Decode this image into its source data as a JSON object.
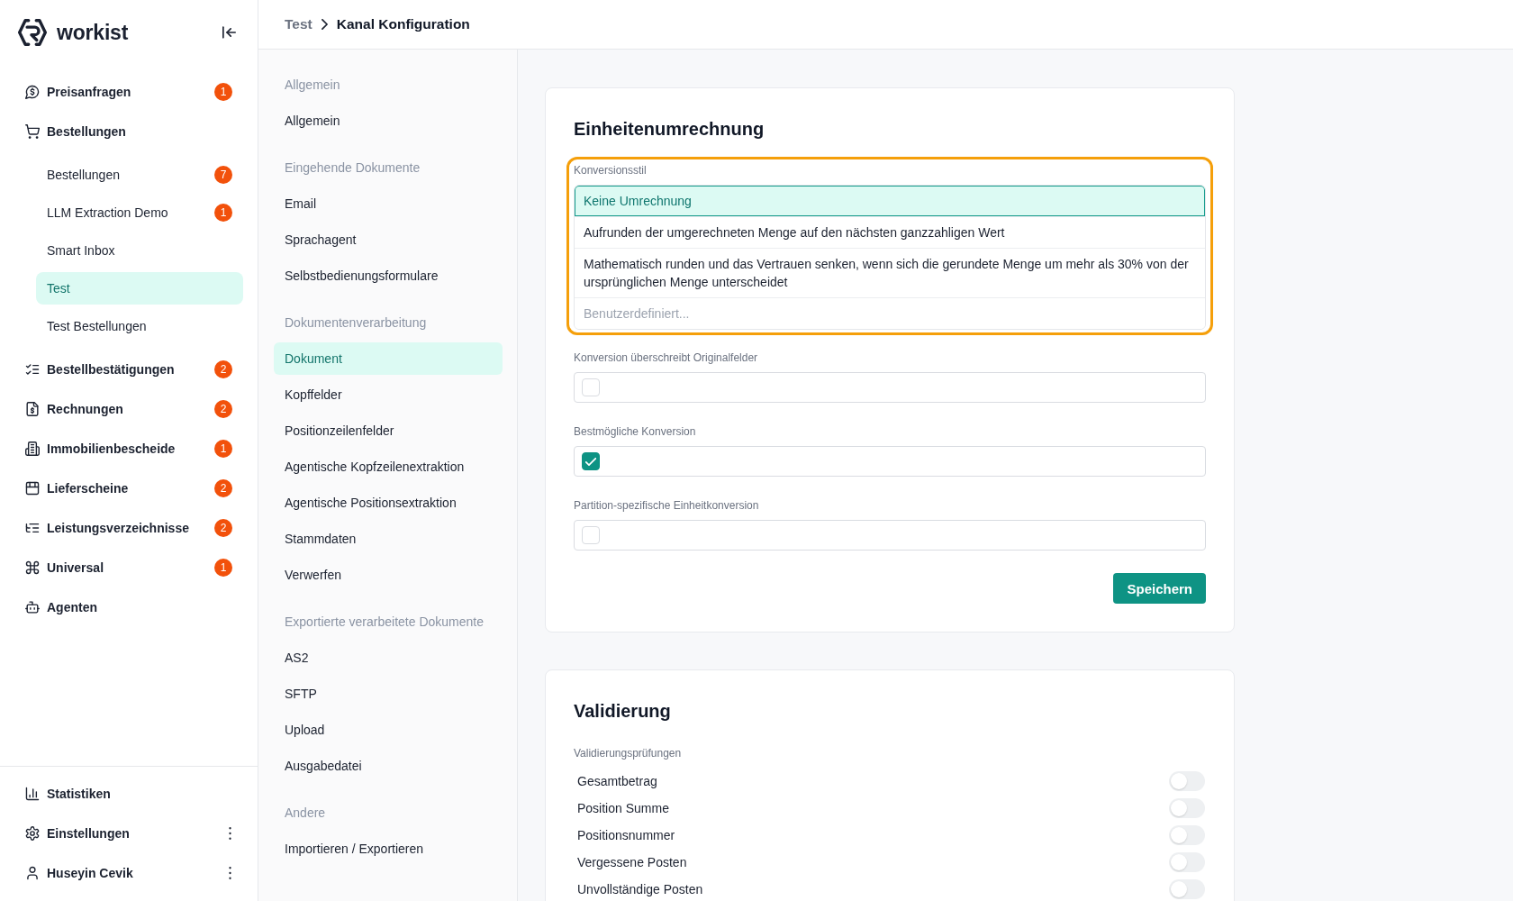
{
  "sidebar": {
    "logo": "workist",
    "nav": [
      {
        "label": "Preisanfragen",
        "badge": "1",
        "selected": false
      },
      {
        "label": "Bestellungen",
        "selected": false,
        "children": [
          {
            "label": "Bestellungen",
            "badge": "7",
            "selected": false
          },
          {
            "label": "LLM Extraction Demo",
            "badge": "1",
            "selected": false
          },
          {
            "label": "Smart Inbox",
            "selected": false
          },
          {
            "label": "Test",
            "selected": true
          },
          {
            "label": "Test Bestellungen",
            "selected": false
          }
        ]
      },
      {
        "label": "Bestellbestätigungen",
        "badge": "2",
        "selected": false
      },
      {
        "label": "Rechnungen",
        "badge": "2",
        "selected": false
      },
      {
        "label": "Immobilienbescheide",
        "badge": "1",
        "selected": false
      },
      {
        "label": "Lieferscheine",
        "badge": "2",
        "selected": false
      },
      {
        "label": "Leistungsverzeichnisse",
        "badge": "2",
        "selected": false
      },
      {
        "label": "Universal",
        "badge": "1",
        "selected": false
      },
      {
        "label": "Agenten",
        "selected": false
      }
    ],
    "footer": [
      {
        "label": "Statistiken",
        "selected": false,
        "menu": false
      },
      {
        "label": "Einstellungen",
        "selected": false,
        "menu": true
      },
      {
        "label": "Huseyin Cevik",
        "selected": false,
        "menu": true
      }
    ]
  },
  "breadcrumb": [
    "Test",
    "Kanal Konfiguration"
  ],
  "config_nav": [
    {
      "heading": "Allgemein",
      "items": [
        {
          "label": "Allgemein",
          "selected": false
        }
      ]
    },
    {
      "heading": "Eingehende Dokumente",
      "items": [
        {
          "label": "Email",
          "selected": false
        },
        {
          "label": "Sprachagent",
          "selected": false
        },
        {
          "label": "Selbstbedienungsformulare",
          "selected": false
        }
      ]
    },
    {
      "heading": "Dokumentenverarbeitung",
      "items": [
        {
          "label": "Dokument",
          "selected": true
        },
        {
          "label": "Kopffelder",
          "selected": false
        },
        {
          "label": "Positionzeilenfelder",
          "selected": false
        },
        {
          "label": "Agentische Kopfzeilenextraktion",
          "selected": false
        },
        {
          "label": "Agentische Positionsextraktion",
          "selected": false
        },
        {
          "label": "Stammdaten",
          "selected": false
        },
        {
          "label": "Verwerfen",
          "selected": false
        }
      ]
    },
    {
      "heading": "Exportierte verarbeitete Dokumente",
      "items": [
        {
          "label": "AS2",
          "selected": false
        },
        {
          "label": "SFTP",
          "selected": false
        },
        {
          "label": "Upload",
          "selected": false
        },
        {
          "label": "Ausgabedatei",
          "selected": false
        }
      ]
    },
    {
      "heading": "Andere",
      "items": [
        {
          "label": "Importieren / Exportieren",
          "selected": false
        }
      ]
    }
  ],
  "unit_conversion": {
    "title": "Einheitenumrechnung",
    "conversion_style": {
      "label": "Konversionsstil",
      "highlighted": true,
      "options": [
        {
          "label": "Keine Umrechnung",
          "selected": true
        },
        {
          "label": "Aufrunden der umgerechneten Menge auf den nächsten ganzzahligen Wert",
          "selected": false
        },
        {
          "label": "Mathematisch runden und das Vertrauen senken, wenn sich die gerundete Menge um mehr als 30% von der ursprünglichen Menge unterscheidet",
          "selected": false
        }
      ],
      "custom": {
        "placeholder": "Benutzerdefiniert..."
      }
    },
    "checkboxes": [
      {
        "label": "Konversion überschreibt Originalfelder",
        "checked": false
      },
      {
        "label": "Bestmögliche Konversion",
        "checked": true
      },
      {
        "label": "Partition-spezifische Einheitkonversion",
        "checked": false
      }
    ],
    "save_button": "Speichern"
  },
  "validation": {
    "title": "Validierung",
    "checks_label": "Validierungsprüfungen",
    "checks": [
      {
        "label": "Gesamtbetrag",
        "on": false
      },
      {
        "label": "Position Summe",
        "on": false
      },
      {
        "label": "Positionsnummer",
        "on": false
      },
      {
        "label": "Vergessene Posten",
        "on": false
      },
      {
        "label": "Unvollständige Posten",
        "on": false
      }
    ]
  }
}
